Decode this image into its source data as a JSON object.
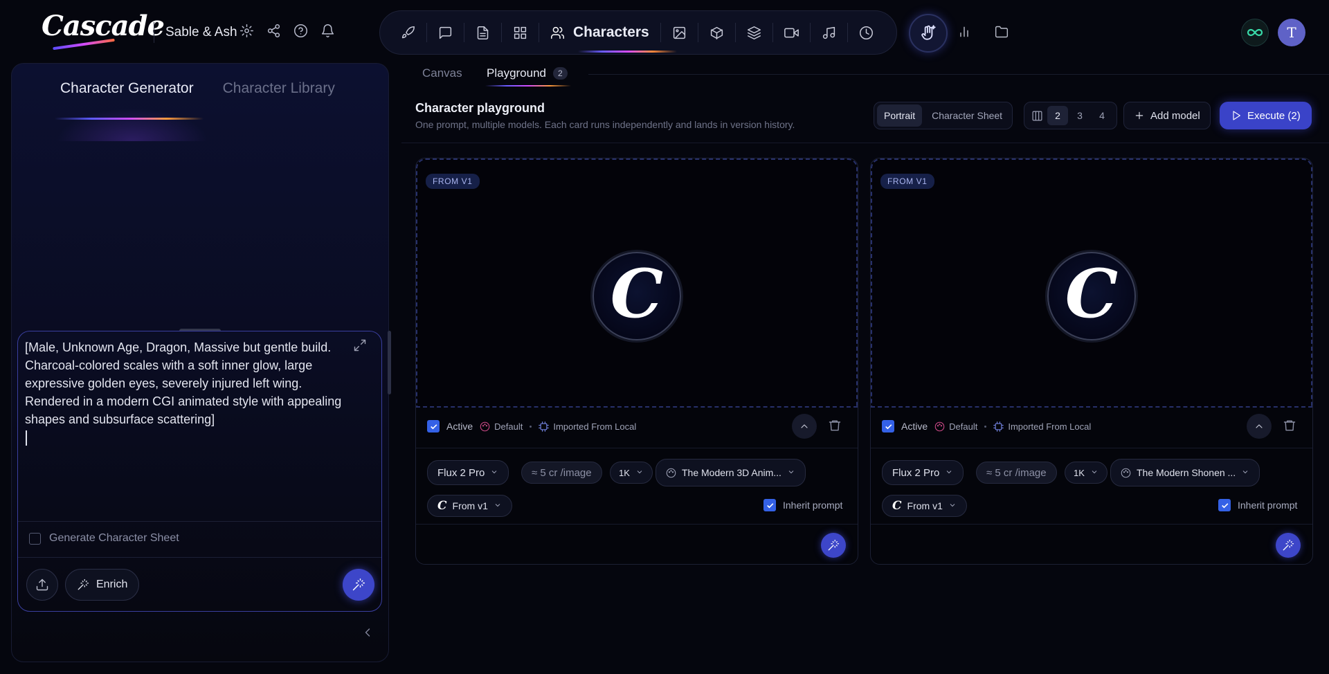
{
  "header": {
    "logo_text": "Cascade",
    "project_name": "Sable & Ash",
    "nav_active_label": "Characters"
  },
  "left_panel": {
    "tabs": [
      {
        "label": "Character Generator",
        "active": true
      },
      {
        "label": "Character Library",
        "active": false
      }
    ],
    "prompt_text": "[Male, Unknown Age, Dragon, Massive but gentle build. Charcoal-colored scales with a soft inner glow, large expressive golden eyes, severely injured left wing. Rendered in a modern CGI animated style with appealing shapes and subsurface scattering]",
    "generate_sheet_label": "Generate Character Sheet",
    "enrich_label": "Enrich"
  },
  "main": {
    "tabs": [
      {
        "label": "Canvas",
        "active": false
      },
      {
        "label": "Playground",
        "active": true,
        "badge": "2"
      }
    ],
    "title": "Character playground",
    "subtitle": "One prompt, multiple models. Each card runs independently and lands in version history.",
    "modes": [
      "Portrait",
      "Character Sheet"
    ],
    "column_options": [
      "2",
      "3",
      "4"
    ],
    "add_model_label": "Add model",
    "execute_label": "Execute (2)"
  },
  "cards": [
    {
      "badge": "FROM V1",
      "active_label": "Active",
      "default_label": "Default",
      "imported_label": "Imported From Local",
      "model": "Flux 2 Pro",
      "cost": "≈ 5 cr  /image",
      "resolution": "1K",
      "style": "The Modern 3D Anim...",
      "version": "From v1",
      "inherit_label": "Inherit prompt"
    },
    {
      "badge": "FROM V1",
      "active_label": "Active",
      "default_label": "Default",
      "imported_label": "Imported From Local",
      "model": "Flux 2 Pro",
      "cost": "≈ 5 cr  /image",
      "resolution": "1K",
      "style": "The Modern Shonen ...",
      "version": "From v1",
      "inherit_label": "Inherit prompt"
    }
  ],
  "colors": {
    "accent": "#3a43c8",
    "checkbox": "#3461e6",
    "background": "#05060e",
    "infinity": "#39d9a8",
    "avatar": "#5f62c7"
  },
  "user": {
    "avatar_letter": "T"
  }
}
